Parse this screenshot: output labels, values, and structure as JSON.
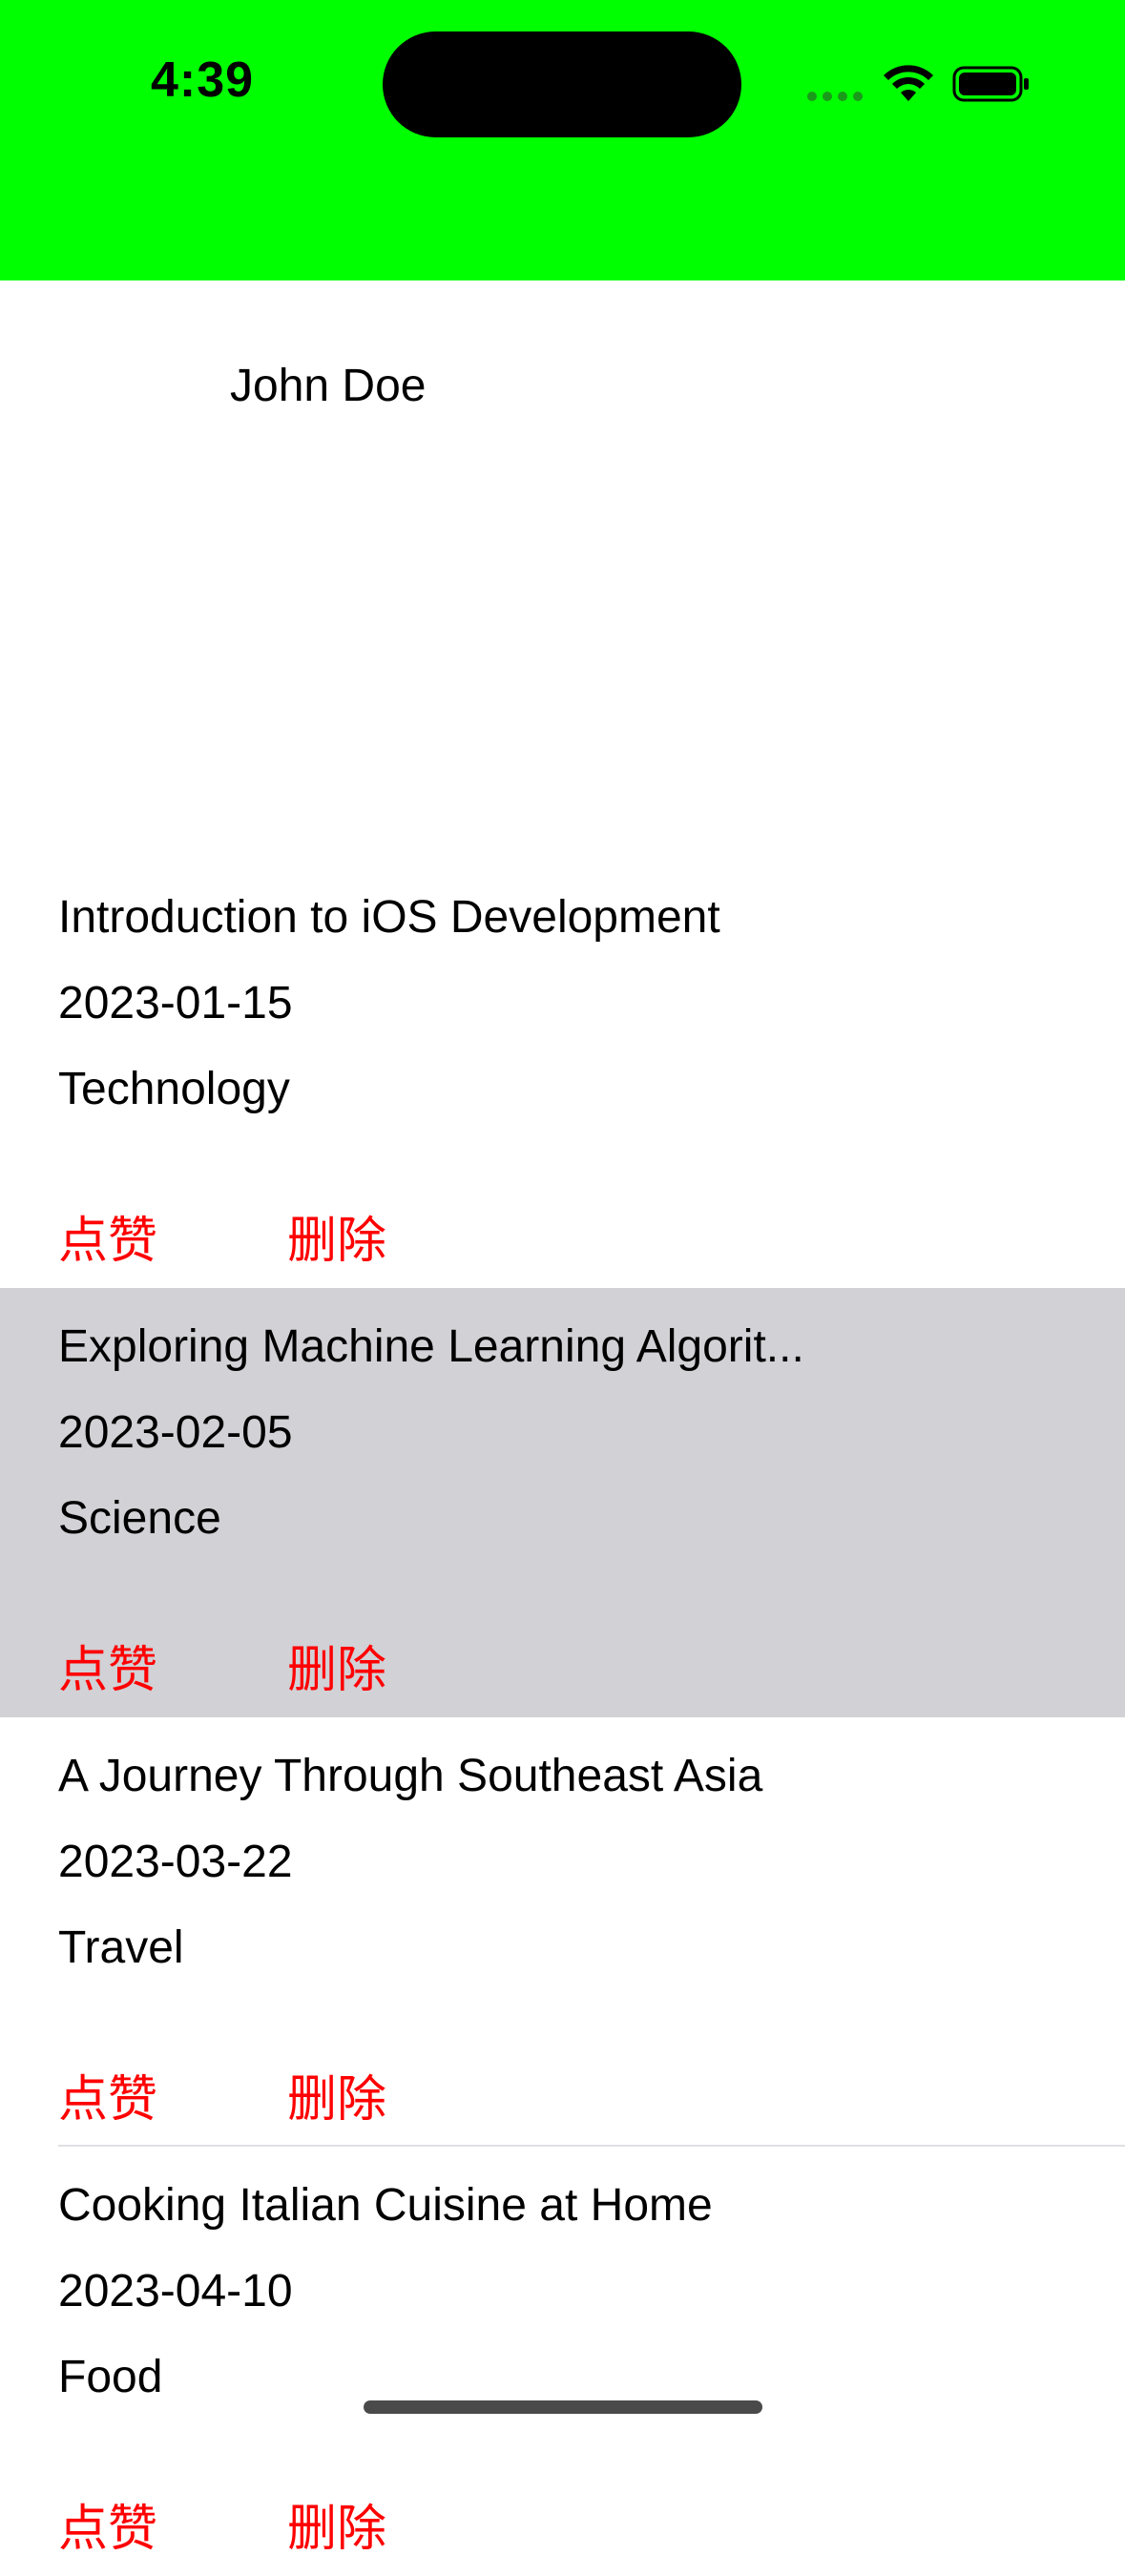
{
  "status_bar": {
    "time": "4:39",
    "background_color": "#00ff00",
    "icons": [
      "signal-icon",
      "wifi-icon",
      "battery-icon"
    ]
  },
  "profile": {
    "name": "John Doe"
  },
  "articles": [
    {
      "title": "Introduction to iOS Development",
      "date": "2023-01-15",
      "category": "Technology",
      "like_label": "点赞",
      "delete_label": "删除"
    },
    {
      "title": "Exploring Machine Learning Algorit...",
      "date": "2023-02-05",
      "category": "Science",
      "like_label": "点赞",
      "delete_label": "删除"
    },
    {
      "title": "A Journey Through Southeast Asia",
      "date": "2023-03-22",
      "category": "Travel",
      "like_label": "点赞",
      "delete_label": "删除"
    },
    {
      "title": "Cooking Italian Cuisine at Home",
      "date": "2023-04-10",
      "category": "Food",
      "like_label": "点赞",
      "delete_label": "删除"
    }
  ],
  "colors": {
    "action_red": "#ff0000",
    "selected_row": "#d1d1d6"
  }
}
